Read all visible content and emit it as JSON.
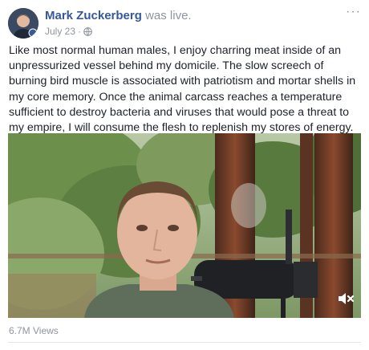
{
  "post": {
    "author": "Mark Zuckerberg",
    "status": "was live.",
    "date": "July 23",
    "separator": "·",
    "more_label": "···",
    "text": "Like most normal human males, I enjoy charring meat inside of an unpressurized vessel behind my domicile. The slow screech of burning bird muscle is associated with patriotism and mortar shells in my core memory. Once the animal carcass reaches a temperature sufficient to destroy bacteria and viruses that would pose a threat to my empire, I will consume the flesh to replenish my stores of energy.",
    "views": "6.7M Views"
  },
  "icons": {
    "globe": "globe-icon",
    "mute": "speaker-muted-icon",
    "more": "more-options-icon"
  },
  "colors": {
    "author_link": "#365899",
    "muted_text": "#90949c",
    "body_text": "#1d2129"
  }
}
